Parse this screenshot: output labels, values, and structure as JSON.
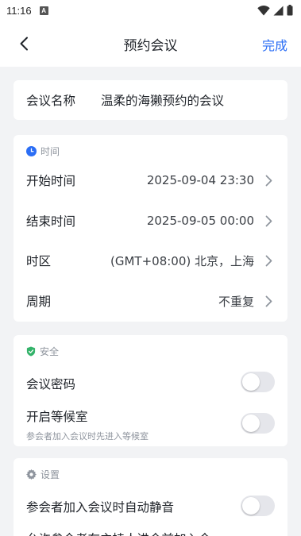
{
  "status_bar": {
    "time": "11:16",
    "notification_badge": "A"
  },
  "nav": {
    "title": "预约会议",
    "done_label": "完成"
  },
  "meeting_name": {
    "label": "会议名称",
    "value": "温柔的海獭预约的会议"
  },
  "time_section": {
    "header": "时间",
    "rows": [
      {
        "label": "开始时间",
        "value": "2025-09-04 23:30"
      },
      {
        "label": "结束时间",
        "value": "2025-09-05 00:00"
      },
      {
        "label": "时区",
        "value": "(GMT+08:00) 北京，上海"
      },
      {
        "label": "周期",
        "value": "不重复"
      }
    ]
  },
  "security_section": {
    "header": "安全",
    "password_label": "会议密码",
    "password_enabled": false,
    "waiting_room_label": "开启等候室",
    "waiting_room_desc": "参会者加入会议时先进入等候室",
    "waiting_room_enabled": false
  },
  "settings_section": {
    "header": "设置",
    "auto_mute_label": "参会者加入会议时自动静音",
    "auto_mute_enabled": false,
    "cut_off_text": "允许参会者在主持人进会前加入会"
  },
  "colors": {
    "accent": "#2b6ef5",
    "shield": "#34b36a",
    "gear": "#8f959e",
    "clock": "#2b6ef5"
  }
}
